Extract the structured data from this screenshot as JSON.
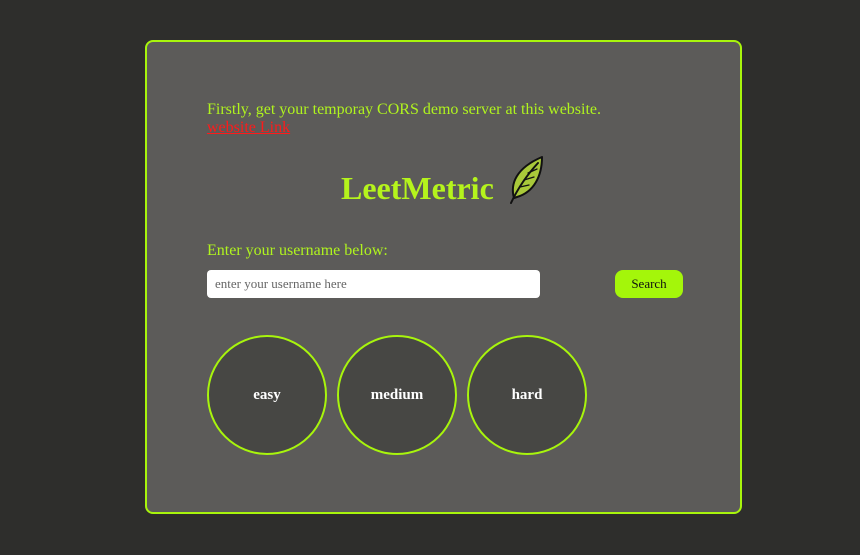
{
  "intro": {
    "text": "Firstly, get your temporay CORS demo server at this website.",
    "link_label": "website Link"
  },
  "header": {
    "title": "LeetMetric",
    "icon": "leaf-icon"
  },
  "search": {
    "prompt": "Enter your username below:",
    "placeholder": "enter your username here",
    "value": "",
    "button_label": "Search"
  },
  "stats": [
    {
      "label": "easy"
    },
    {
      "label": "medium"
    },
    {
      "label": "hard"
    }
  ],
  "colors": {
    "accent": "#a8f50c",
    "background": "#2e2e2c",
    "card": "#5c5b59",
    "circle": "#474744",
    "link": "#ff1a1a"
  }
}
